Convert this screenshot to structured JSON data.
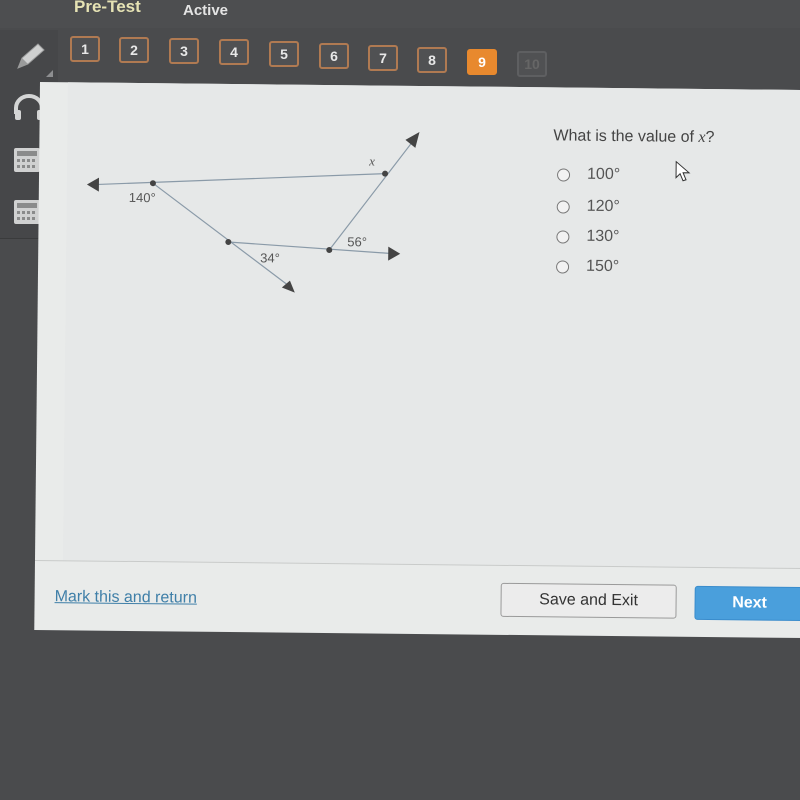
{
  "header": {
    "title": "Pre-Test",
    "status": "Active"
  },
  "question_nav": {
    "items": [
      {
        "label": "1",
        "state": "answered"
      },
      {
        "label": "2",
        "state": "answered"
      },
      {
        "label": "3",
        "state": "answered"
      },
      {
        "label": "4",
        "state": "answered"
      },
      {
        "label": "5",
        "state": "answered"
      },
      {
        "label": "6",
        "state": "answered"
      },
      {
        "label": "7",
        "state": "answered"
      },
      {
        "label": "8",
        "state": "answered"
      },
      {
        "label": "9",
        "state": "current"
      },
      {
        "label": "10",
        "state": "disabled"
      }
    ],
    "current_color": "#e8892e"
  },
  "tools": [
    {
      "icon": "pencil-icon"
    },
    {
      "icon": "headphones-icon"
    },
    {
      "icon": "calculator-icon"
    },
    {
      "icon": "calculator-icon"
    }
  ],
  "diagram": {
    "labels": {
      "angle_left": "140°",
      "angle_bottom": "34°",
      "angle_right": "56°",
      "unknown": "x"
    }
  },
  "question": {
    "prompt_prefix": "What is the value of ",
    "variable": "x",
    "prompt_suffix": "?",
    "options": [
      "100°",
      "120°",
      "130°",
      "150°"
    ]
  },
  "footer": {
    "mark_link": "Mark this and return",
    "save_label": "Save and Exit",
    "next_label": "Next"
  }
}
